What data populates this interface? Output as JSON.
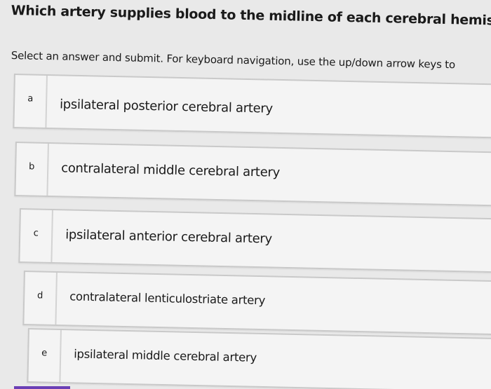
{
  "question": {
    "text": "Which artery supplies blood to the midline of each cerebral hemisphere?"
  },
  "instructions": {
    "text": "Select an answer and submit. For keyboard navigation, use the up/down arrow keys to"
  },
  "options": [
    {
      "letter": "a",
      "label": "ipsilateral posterior cerebral artery"
    },
    {
      "letter": "b",
      "label": "contralateral middle cerebral artery"
    },
    {
      "letter": "c",
      "label": "ipsilateral anterior cerebral artery"
    },
    {
      "letter": "d",
      "label": "contralateral lenticulostriate artery"
    },
    {
      "letter": "e",
      "label": "ipsilateral middle cerebral artery"
    }
  ],
  "colors": {
    "background": "#e9e9e9",
    "option_background": "#f4f4f4",
    "option_border": "#c9c9c9",
    "accent": "#6a3fb5"
  }
}
